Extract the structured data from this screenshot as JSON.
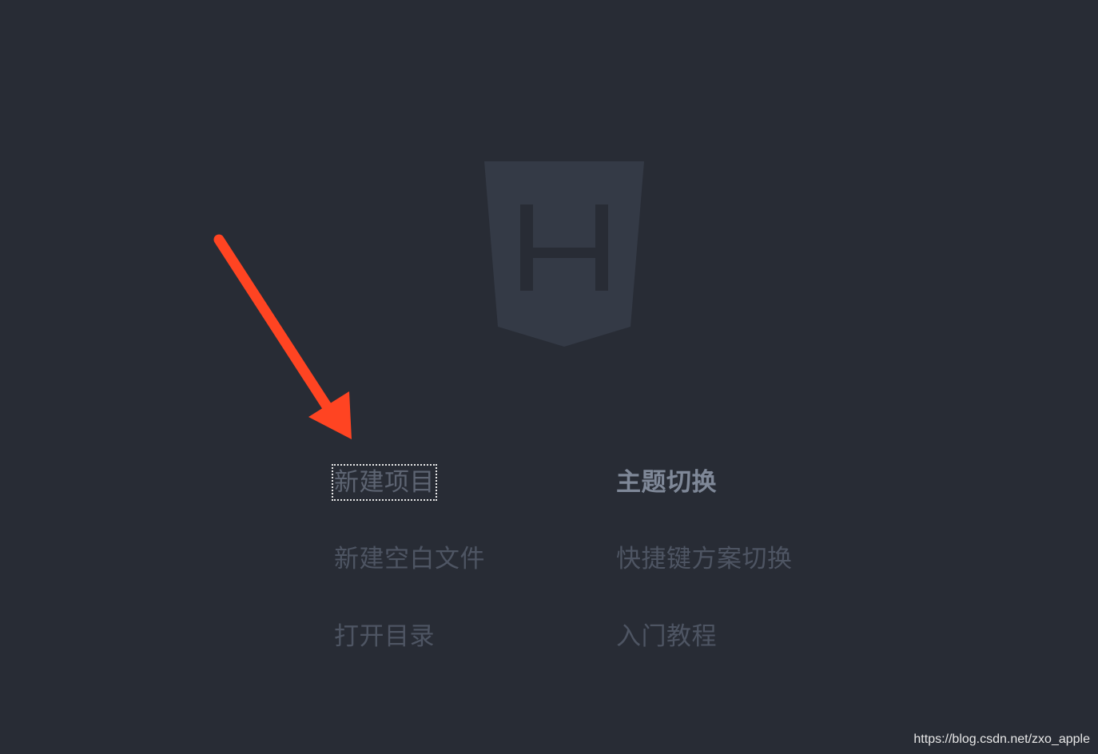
{
  "logo": {
    "icon": "hbuilder-shield-icon",
    "letter": "H"
  },
  "menu": {
    "left": [
      {
        "label": "新建项目",
        "state": "focused"
      },
      {
        "label": "新建空白文件",
        "state": "normal"
      },
      {
        "label": "打开目录",
        "state": "normal"
      }
    ],
    "right": [
      {
        "label": "主题切换",
        "state": "active"
      },
      {
        "label": "快捷键方案切换",
        "state": "normal"
      },
      {
        "label": "入门教程",
        "state": "normal"
      }
    ]
  },
  "annotation": {
    "icon": "red-arrow-icon",
    "color": "#ff4422"
  },
  "watermark": "https://blog.csdn.net/zxo_apple",
  "colors": {
    "background": "#282c35",
    "logo_fill": "#343a46",
    "logo_letter": "#282c35",
    "link_text": "#4e5563",
    "link_active": "#7f8898"
  }
}
